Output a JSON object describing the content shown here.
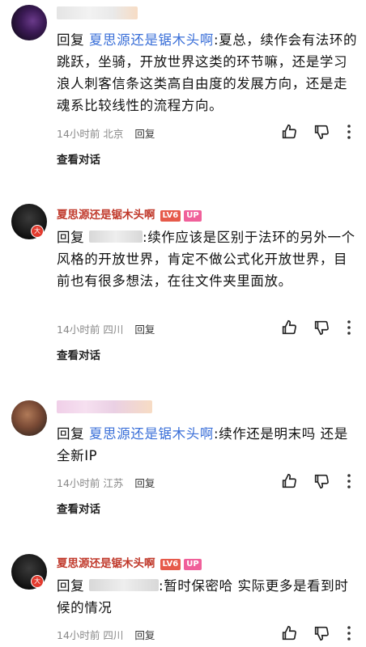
{
  "colors": {
    "username": "#c0392b",
    "mention": "#3a6fd8",
    "level_badge": "#e65a4a",
    "up_badge": "#f0609a",
    "meta": "#888888"
  },
  "comments": [
    {
      "avatar": "purple",
      "reply_prefix": "回复 ",
      "mention": "夏思源还是锯木头啊",
      "text": ":夏总，续作会有法环的跳跃，坐骑，开放世界这类的环节嘛，还是学习浪人刺客信条这类高自由度的发展方向，还是走魂系比较线性的流程方向。",
      "time": "14小时前",
      "location": "北京",
      "reply_label": "回复",
      "view_conversation": "查看对话"
    },
    {
      "avatar": "dark",
      "badge": "大",
      "username": "夏思源还是锯木头啊",
      "level": "LV6",
      "up_tag": "UP",
      "reply_prefix": "回复 ",
      "text": ":续作应该是区别于法环的另外一个风格的开放世界，肯定不做公式化开放世界，目前也有很多想法，在往文件夹里面放。",
      "time": "14小时前",
      "location": "四川",
      "reply_label": "回复",
      "view_conversation": "查看对话"
    },
    {
      "avatar": "tan",
      "reply_prefix": "回复 ",
      "mention": "夏思源还是锯木头啊",
      "text": ":续作还是明末吗 还是全新IP",
      "time": "14小时前",
      "location": "江苏",
      "reply_label": "回复",
      "view_conversation": "查看对话"
    },
    {
      "avatar": "dark",
      "badge": "大",
      "username": "夏思源还是锯木头啊",
      "level": "LV6",
      "up_tag": "UP",
      "reply_prefix": "回复 ",
      "text": ":暂时保密哈  实际更多是看到时候的情况",
      "time": "14小时前",
      "location": "四川",
      "reply_label": "回复"
    }
  ]
}
